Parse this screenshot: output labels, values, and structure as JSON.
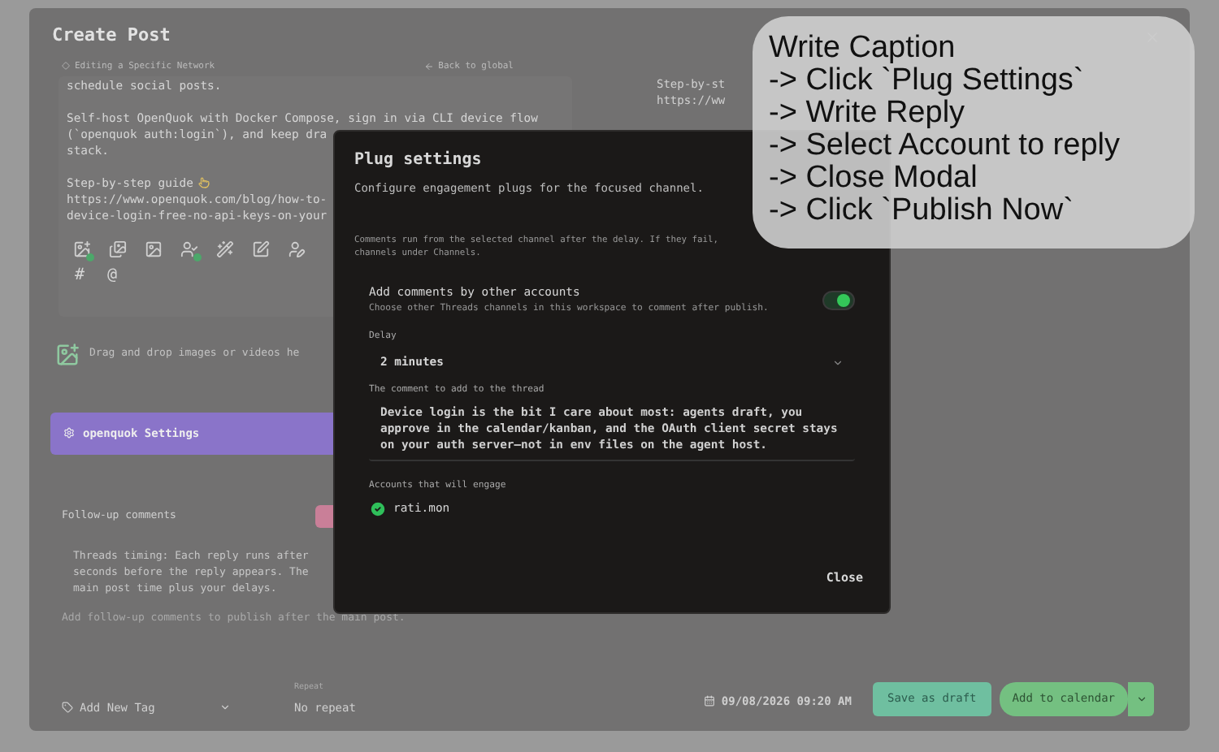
{
  "page": {
    "title": "Create Post",
    "editing_label": "Editing a Specific Network",
    "back_link": "Back to global"
  },
  "editor": {
    "paragraphs": [
      [
        "schedule social posts."
      ],
      [
        "Self-host OpenQuok with Docker Compose, sign in via CLI device flow",
        "(`openquok auth:login`), and keep dra",
        "stack."
      ],
      [
        "Step-by-step guide",
        "https://www.openquok.com/blog/how-to-",
        "device-login-free-no-api-keys-on-your"
      ]
    ],
    "tools": [
      {
        "kind": "image-add",
        "badge": true
      },
      {
        "kind": "images",
        "badge": false
      },
      {
        "kind": "image",
        "badge": false
      },
      {
        "kind": "user",
        "badge": true
      },
      {
        "kind": "wand",
        "badge": false
      },
      {
        "kind": "edit",
        "badge": false
      },
      {
        "kind": "user-edit",
        "badge": false
      }
    ],
    "symbols": [
      "#",
      "@"
    ]
  },
  "preview": {
    "lines": [
      "Step-by-st",
      "https://ww"
    ]
  },
  "drop_zone": "Drag and drop images or videos he",
  "settings_bar": "openquok Settings",
  "followups": {
    "title": "Follow-up comments",
    "timing_lines": [
      "Threads timing: Each reply runs after",
      "seconds before the reply appears. The",
      "main post time plus your delays."
    ],
    "hint": "Add follow-up comments to publish after the main post."
  },
  "footer": {
    "tag": "Add New Tag",
    "repeat_label": "Repeat",
    "repeat_value": "No repeat",
    "date": "09/08/2026 09:20 AM",
    "save": "Save as draft",
    "add": "Add to calendar"
  },
  "modal": {
    "title": "Plug settings",
    "subtitle": "Configure engagement plugs for the focused channel.",
    "note_lines": [
      "Comments run from the selected channel after the delay. If they fail,",
      "channels under Channels."
    ],
    "toggle": {
      "label": "Add comments by other accounts",
      "description": "Choose other Threads channels in this workspace to comment after publish.",
      "on": true
    },
    "delay": {
      "label": "Delay",
      "value": "2 minutes"
    },
    "comment": {
      "label": "The comment to add to the thread",
      "value": "Device login is the bit I care about most: agents draft, you approve in the calendar/kanban, and the OAuth client secret stays on your auth server—not in env files on the agent host."
    },
    "accounts_label": "Accounts that will engage",
    "accounts": [
      {
        "name": "rati.mon",
        "selected": true
      }
    ],
    "close": "Close"
  },
  "caption": [
    "Write Caption",
    "-> Click `Plug Settings`",
    "-> Write Reply",
    "-> Select Account to reply",
    "-> Close Modal",
    "-> Click `Publish Now`"
  ]
}
